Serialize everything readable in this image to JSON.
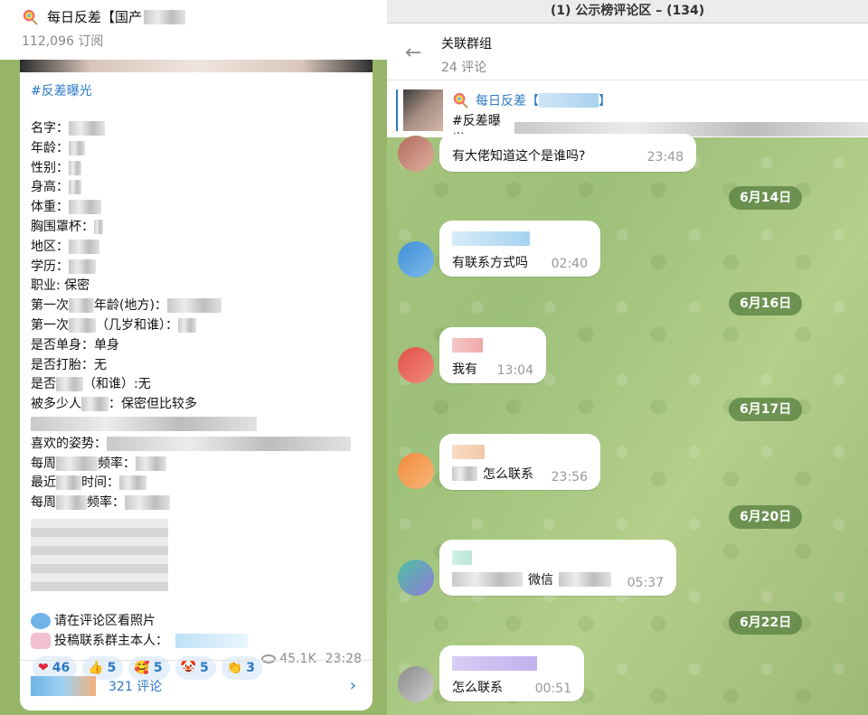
{
  "channel": {
    "title": "每日反差【国产",
    "subscribers": "112,096 订阅"
  },
  "post": {
    "hashtag": "#反差曝光",
    "fields": [
      "名字：",
      "年龄：",
      "性别：",
      "身高：",
      "体重：",
      "胸围罩杯：",
      "地区：",
      "学历：",
      "职业: 保密",
      "第一次",
      "第一次",
      "是否单身：单身",
      "是否打胎：无",
      "是否",
      "被多少人",
      "",
      "喜欢的姿势：",
      "每周",
      "最近",
      "每周"
    ],
    "field_extras": [
      "",
      "",
      "",
      "",
      "",
      "",
      "",
      "",
      "",
      "年龄(地方)：",
      "（几岁和谁）：",
      "",
      "",
      "（和谁）:无",
      "：保密但比较多",
      "",
      "",
      "频率：",
      "时间：",
      "频率："
    ],
    "note_photos": "请在评论区看照片",
    "note_contact": "投稿联系群主本人：",
    "reactions": [
      {
        "icon": "heart-icon",
        "glyph": "❤",
        "count": "46"
      },
      {
        "icon": "thumbs-up-icon",
        "glyph": "👍",
        "count": "5"
      },
      {
        "icon": "party-face-icon",
        "glyph": "🥰",
        "count": "5"
      },
      {
        "icon": "clown-face-icon",
        "glyph": "🤡",
        "count": "5"
      },
      {
        "icon": "clapping-icon",
        "glyph": "👏",
        "count": "3"
      }
    ],
    "views": "45.1K",
    "time": "23:28",
    "comments": "321 评论"
  },
  "window": {
    "title": "(1)         公示榜评论区 – (134)"
  },
  "group": {
    "title": "关联群组",
    "subtitle": "24 评论",
    "pinned_title": "每日反差【",
    "pinned_bracket": "】",
    "pinned_text": "#反差曝光"
  },
  "messages": [
    {
      "text": "有大佬知道这个是谁吗?",
      "time": "23:48"
    },
    {
      "date": "6月14日"
    },
    {
      "text": "有联系方式吗",
      "time": "02:40"
    },
    {
      "date": "6月16日"
    },
    {
      "text": "我有",
      "time": "13:04"
    },
    {
      "date": "6月17日"
    },
    {
      "text": "怎么联系",
      "time": "23:56"
    },
    {
      "date": "6月20日"
    },
    {
      "text": "微信",
      "time": "05:37"
    },
    {
      "date": "6月22日"
    },
    {
      "text": "怎么联系",
      "time": "00:51"
    }
  ],
  "colors": {
    "accent": "#2b79c5",
    "date_pill": "#5a8241",
    "chat_bg": "#a8c57e"
  }
}
